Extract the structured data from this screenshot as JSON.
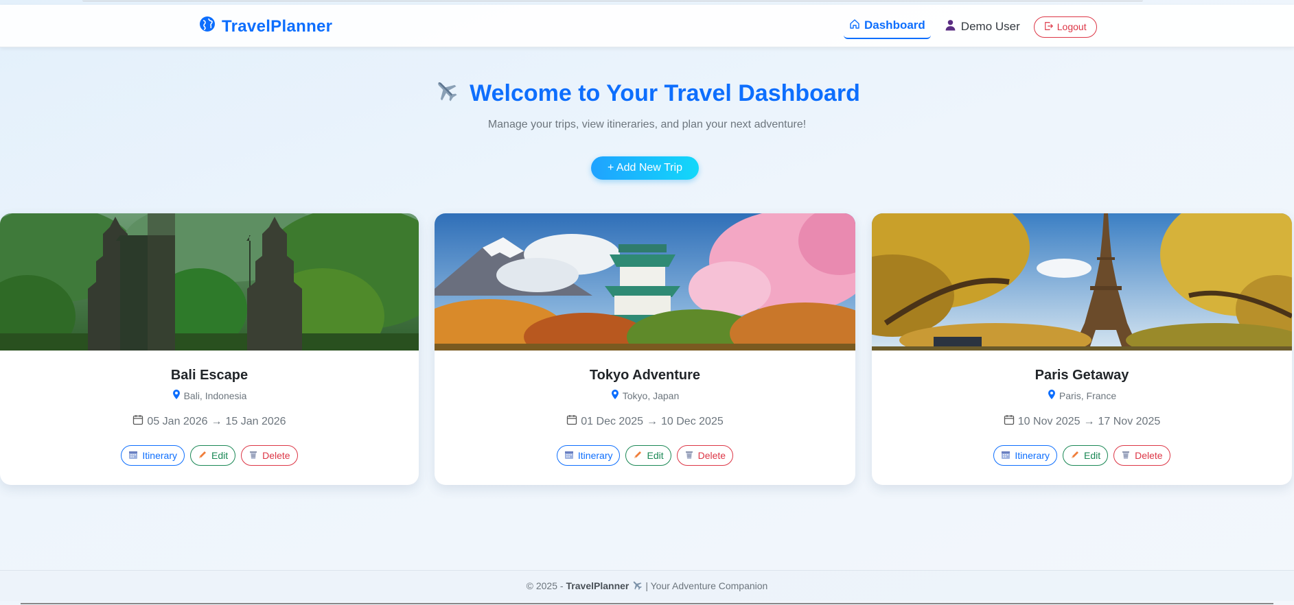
{
  "colors": {
    "primary": "#0d6efd",
    "danger": "#dc3545",
    "success": "#198754",
    "muted": "#6c757d"
  },
  "navbar": {
    "brand": "TravelPlanner",
    "brand_icon": "globe-icon",
    "dashboard_label": "Dashboard",
    "user_label": "Demo User",
    "logout_label": "Logout"
  },
  "hero": {
    "title": "Welcome to Your Travel Dashboard",
    "subtitle": "Manage your trips, view itineraries, and plan your next adventure!",
    "add_button": "+ Add New Trip"
  },
  "trips": [
    {
      "title": "Bali Escape",
      "location": "Bali, Indonesia",
      "start": "05 Jan 2026",
      "end": "15 Jan 2026",
      "arrow": "→"
    },
    {
      "title": "Tokyo Adventure",
      "location": "Tokyo, Japan",
      "start": "01 Dec 2025",
      "end": "10 Dec 2025",
      "arrow": "→"
    },
    {
      "title": "Paris Getaway",
      "location": "Paris, France",
      "start": "10 Nov 2025",
      "end": "17 Nov 2025",
      "arrow": "→"
    }
  ],
  "card_actions": {
    "itinerary": "Itinerary",
    "edit": "Edit",
    "delete": "Delete"
  },
  "footer": {
    "prefix": "© 2025 -",
    "brand": "TravelPlanner",
    "suffix": "| Your Adventure Companion"
  }
}
